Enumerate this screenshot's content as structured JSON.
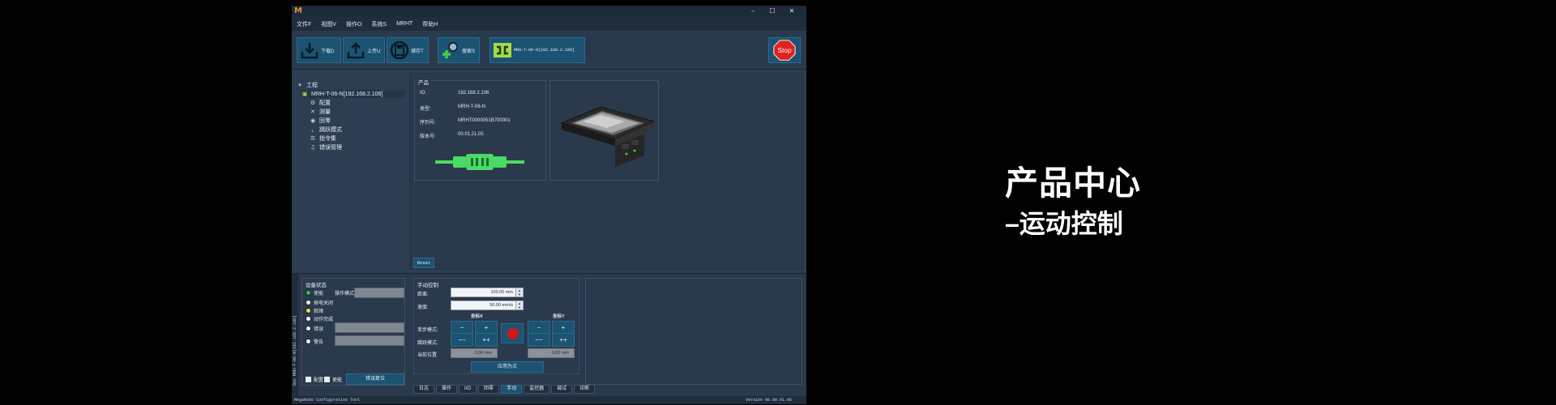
{
  "menu": [
    "文件F",
    "视图V",
    "操作O",
    "系统S",
    "MRHT",
    "帮助H"
  ],
  "window_controls": [
    "–",
    "☐",
    "✕"
  ],
  "toolbar": {
    "download_label": "下载D",
    "upload_label": "上传U",
    "save_label": "储存T",
    "search_label": "搜索S",
    "device_label": "MRH-T-06-N[192.168.2.106]",
    "stop_label": "Stop"
  },
  "tree": {
    "root": "工程",
    "device": "MRH-T-06-N[192.168.2.106]",
    "items": [
      "配置",
      "测量",
      "回零",
      "跳跃模式",
      "指令集",
      "错误管理"
    ]
  },
  "product": {
    "title": "产品",
    "rows": [
      {
        "key": "IO:",
        "value": "192.168.2.106"
      },
      {
        "key": "类型:",
        "value": "MRH-T-06-N"
      },
      {
        "key": "序列号:",
        "value": "MRHT0000051B700001"
      },
      {
        "key": "版本号:",
        "value": "00.01.21.05"
      }
    ]
  },
  "reset_label": "Reset",
  "device_status": {
    "title": "设备状态",
    "op_mode_label": "操作模式",
    "states": [
      {
        "label": "使能",
        "color": "#2fc14a"
      },
      {
        "label": "掉电关闭",
        "color": "#ffffff"
      },
      {
        "label": "就绪",
        "color": "#f0e23a"
      },
      {
        "label": "动作完成",
        "color": "#ffffff"
      },
      {
        "label": "错误",
        "color": "#ffffff"
      },
      {
        "label": "警告",
        "color": "#ffffff"
      }
    ],
    "config_check": "配置",
    "enable_check": "使能",
    "clear_error_button": "错误复位"
  },
  "manual": {
    "title": "手动控制",
    "distance_label": "距离:",
    "distance_value": "100.00 mm",
    "speed_label": "速度:",
    "speed_value": "50.00 mm/s",
    "axis_x": "坐标X",
    "axis_y": "坐标Y",
    "step_mode_label": "单步模式:",
    "jump_mode_label": "跳跃模式:",
    "current_pos_label": "当前位置",
    "pos_x": "0.00 mm",
    "pos_y": "0.00 mm",
    "jog_minus": "−",
    "jog_plus": "+",
    "jog_minus2": "−−",
    "jog_plus2": "++",
    "apply_button": "应用为点"
  },
  "bottom_tabs": [
    "日志",
    "操作",
    "I/O",
    "回零",
    "手动",
    "监控器",
    "调试",
    "诊断"
  ],
  "active_tab": "手动",
  "vertical_tab": "Dpc MRH-T-06-N[192.168.2.106]",
  "status": {
    "left": "MegaRobo Configuration Tool",
    "right": "Version 00.00.01.06"
  },
  "caption": {
    "line1": "产品中心",
    "line2": "–运动控制"
  },
  "colors": {
    "accent": "#1c5372",
    "stop_red": "#d21818",
    "connector_green": "#4cd964"
  }
}
